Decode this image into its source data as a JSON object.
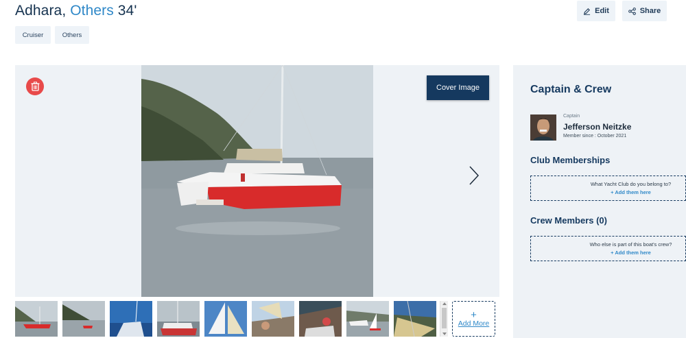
{
  "header": {
    "boat_name": "Adhara,",
    "brand": "Others",
    "length": "34'",
    "edit_label": "Edit",
    "share_label": "Share"
  },
  "tags": [
    "Cruiser",
    "Others"
  ],
  "gallery": {
    "cover_label": "Cover Image",
    "add_more_label": "Add More",
    "thumbnail_count": 9
  },
  "panel": {
    "title": "Captain & Crew",
    "captain_role": "Captain",
    "captain_name": "Jefferson Neitzke",
    "captain_since": "Member since : October 2021",
    "club_title": "Club Memberships",
    "club_question": "What Yacht Club do you belong to?",
    "club_action": "+ Add them here",
    "crew_title": "Crew Members (0)",
    "crew_question": "Who else is part of this boat's crew?",
    "crew_action": "+ Add them here"
  },
  "colors": {
    "accent_blue": "#2f88c8",
    "navy": "#15395f",
    "delete_red": "#e84a4a",
    "panel_bg": "#eef2f6"
  },
  "icons": [
    "edit-icon",
    "share-icon",
    "trash-icon",
    "chevron-right-icon",
    "plus-icon"
  ]
}
